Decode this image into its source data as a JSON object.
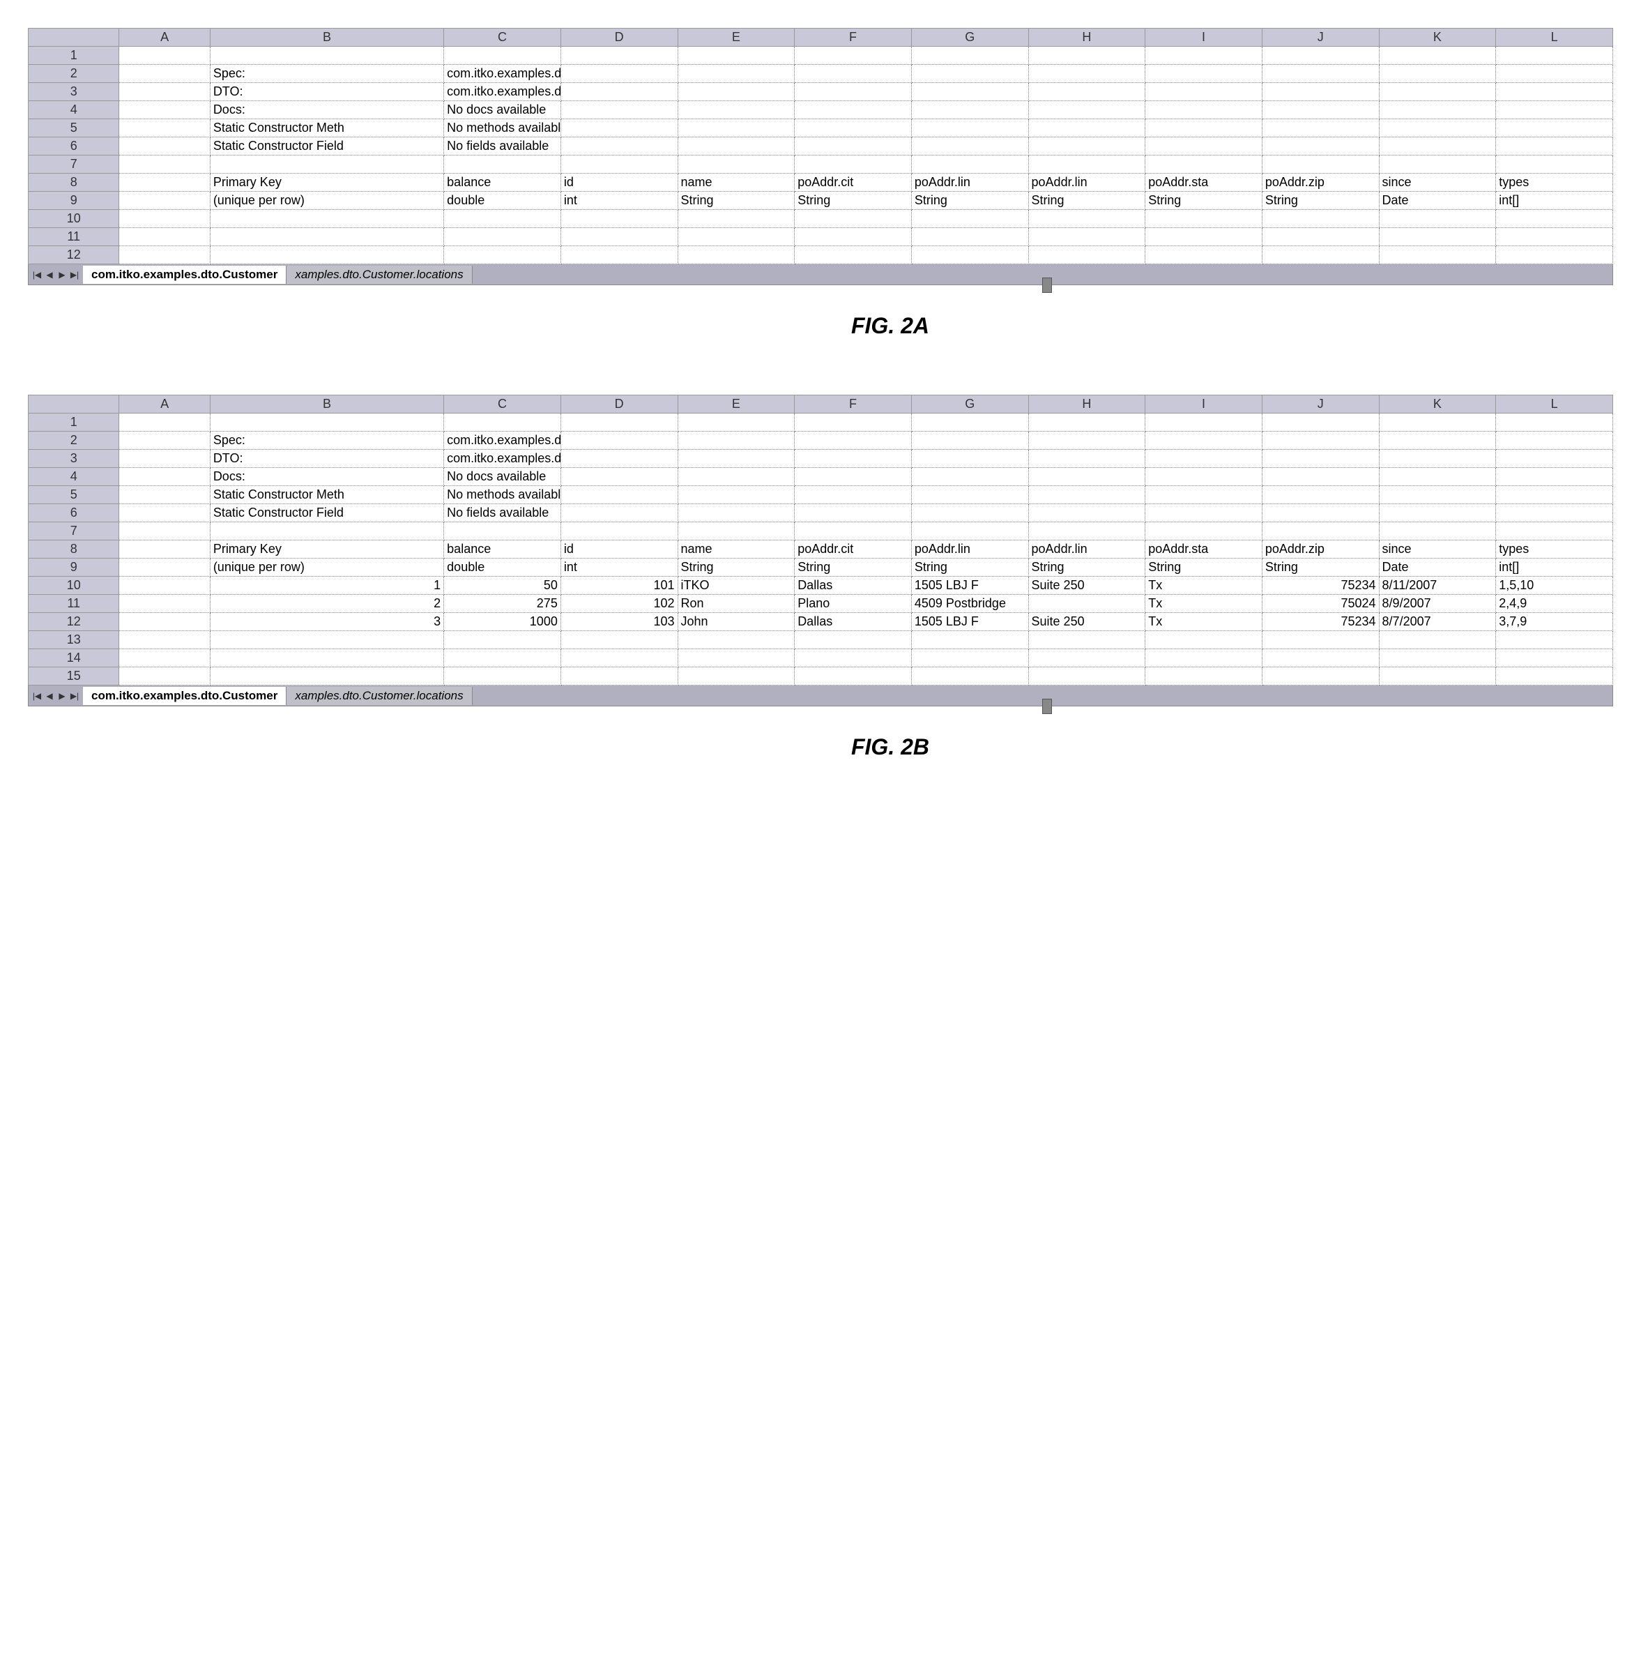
{
  "figA": {
    "label": "FIG. 2A",
    "columns": [
      "",
      "A",
      "B",
      "C",
      "D",
      "E",
      "F",
      "G",
      "H",
      "I",
      "J",
      "K",
      "L"
    ],
    "rows": [
      [
        "1",
        "",
        "",
        "",
        "",
        "",
        "",
        "",
        "",
        "",
        "",
        "",
        ""
      ],
      [
        "2",
        "",
        "Spec:",
        "com.itko.examples.dto.Customer",
        "",
        "",
        "",
        "",
        "",
        "",
        "",
        "",
        ""
      ],
      [
        "3",
        "",
        "DTO:",
        "com.itko.examples.dto.Customer",
        "",
        "",
        "",
        "",
        "",
        "",
        "",
        "",
        ""
      ],
      [
        "4",
        "",
        "Docs:",
        "No docs available",
        "",
        "",
        "",
        "",
        "",
        "",
        "",
        "",
        ""
      ],
      [
        "5",
        "",
        "Static Constructor Meth",
        "No methods available",
        "",
        "",
        "",
        "",
        "",
        "",
        "",
        "",
        ""
      ],
      [
        "6",
        "",
        "Static Constructor Field",
        "No fields available",
        "",
        "",
        "",
        "",
        "",
        "",
        "",
        "",
        ""
      ],
      [
        "7",
        "",
        "",
        "",
        "",
        "",
        "",
        "",
        "",
        "",
        "",
        "",
        ""
      ],
      [
        "8",
        "",
        "Primary Key",
        "balance",
        "id",
        "name",
        "poAddr.cit",
        "poAddr.lin",
        "poAddr.lin",
        "poAddr.sta",
        "poAddr.zip",
        "since",
        "types"
      ],
      [
        "9",
        "",
        "(unique per row)",
        "double",
        "int",
        "String",
        "String",
        "String",
        "String",
        "String",
        "String",
        "Date",
        "int[]"
      ],
      [
        "10",
        "",
        "",
        "",
        "",
        "",
        "",
        "",
        "",
        "",
        "",
        "",
        ""
      ],
      [
        "11",
        "",
        "",
        "",
        "",
        "",
        "",
        "",
        "",
        "",
        "",
        "",
        ""
      ],
      [
        "12",
        "",
        "",
        "",
        "",
        "",
        "",
        "",
        "",
        "",
        "",
        "",
        ""
      ]
    ],
    "tabs": {
      "active": "com.itko.examples.dto.Customer",
      "inactive": "xamples.dto.Customer.locations"
    }
  },
  "figB": {
    "label": "FIG. 2B",
    "columns": [
      "",
      "A",
      "B",
      "C",
      "D",
      "E",
      "F",
      "G",
      "H",
      "I",
      "J",
      "K",
      "L"
    ],
    "rows": [
      [
        "1",
        "",
        "",
        "",
        "",
        "",
        "",
        "",
        "",
        "",
        "",
        "",
        ""
      ],
      [
        "2",
        "",
        "Spec:",
        "com.itko.examples.dto.Customer",
        "",
        "",
        "",
        "",
        "",
        "",
        "",
        "",
        ""
      ],
      [
        "3",
        "",
        "DTO:",
        "com.itko.examples.dto.Customer",
        "",
        "",
        "",
        "",
        "",
        "",
        "",
        "",
        ""
      ],
      [
        "4",
        "",
        "Docs:",
        "No docs available",
        "",
        "",
        "",
        "",
        "",
        "",
        "",
        "",
        ""
      ],
      [
        "5",
        "",
        "Static Constructor Meth",
        "No methods available",
        "",
        "",
        "",
        "",
        "",
        "",
        "",
        "",
        ""
      ],
      [
        "6",
        "",
        "Static Constructor Field",
        "No fields available",
        "",
        "",
        "",
        "",
        "",
        "",
        "",
        "",
        ""
      ],
      [
        "7",
        "",
        "",
        "",
        "",
        "",
        "",
        "",
        "",
        "",
        "",
        "",
        ""
      ],
      [
        "8",
        "",
        "Primary Key",
        "balance",
        "id",
        "name",
        "poAddr.cit",
        "poAddr.lin",
        "poAddr.lin",
        "poAddr.sta",
        "poAddr.zip",
        "since",
        "types"
      ],
      [
        "9",
        "",
        "(unique per row)",
        "double",
        "int",
        "String",
        "String",
        "String",
        "String",
        "String",
        "String",
        "Date",
        "int[]"
      ],
      [
        "10",
        "",
        "1",
        "50",
        "101",
        "iTKO",
        "Dallas",
        "1505 LBJ F",
        "Suite 250",
        "Tx",
        "75234",
        "8/11/2007",
        "1,5,10"
      ],
      [
        "11",
        "",
        "2",
        "275",
        "102",
        "Ron",
        "Plano",
        "4509 Postbridge",
        "",
        "Tx",
        "75024",
        "8/9/2007",
        "2,4,9"
      ],
      [
        "12",
        "",
        "3",
        "1000",
        "103",
        "John",
        "Dallas",
        "1505 LBJ F",
        "Suite 250",
        "Tx",
        "75234",
        "8/7/2007",
        "3,7,9"
      ],
      [
        "13",
        "",
        "",
        "",
        "",
        "",
        "",
        "",
        "",
        "",
        "",
        "",
        ""
      ],
      [
        "14",
        "",
        "",
        "",
        "",
        "",
        "",
        "",
        "",
        "",
        "",
        "",
        ""
      ],
      [
        "15",
        "",
        "",
        "",
        "",
        "",
        "",
        "",
        "",
        "",
        "",
        "",
        ""
      ]
    ],
    "tabs": {
      "active": "com.itko.examples.dto.Customer",
      "inactive": "xamples.dto.Customer.locations"
    }
  },
  "nav_icons": {
    "first": "|◀",
    "prev": "◀",
    "next": "▶",
    "last": "▶|"
  }
}
